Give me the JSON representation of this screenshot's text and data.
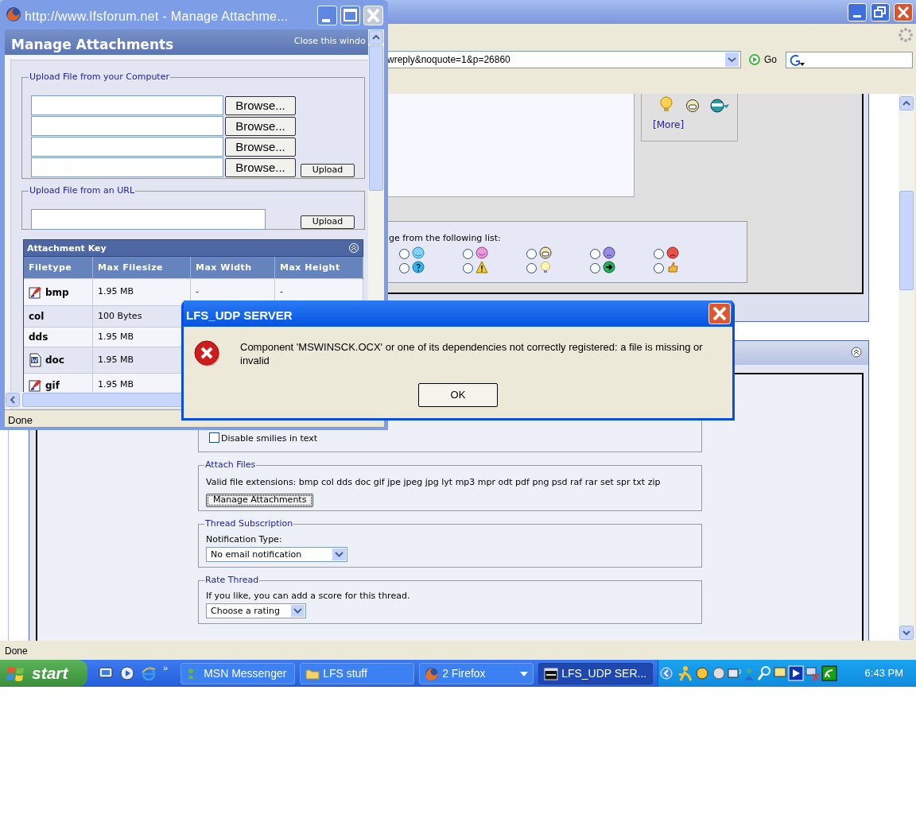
{
  "browser": {
    "address": "wreply&noquote=1&p=26860",
    "go": "Go",
    "status": "Done",
    "smilies_more": "[More]",
    "message_icon_prompt": "ge from the following list:",
    "message_icons": [
      {
        "selected": false
      },
      {
        "selected": false
      },
      {
        "selected": false
      },
      {
        "selected": false
      },
      {
        "selected": false
      },
      {
        "selected": false
      },
      {
        "selected": false
      },
      {
        "selected": false
      },
      {
        "selected": false
      },
      {
        "selected": false
      }
    ],
    "disable_smilies": {
      "label": "Disable smilies in text",
      "checked": false
    },
    "attach": {
      "legend": "Attach Files",
      "extensions": "Valid file extensions: bmp col dds doc gif jpe jpeg jpg lyt mp3 mpr odt pdf png psd raf rar set spr txt zip",
      "button": "Manage Attachments"
    },
    "subscription": {
      "legend": "Thread Subscription",
      "label": "Notification Type:",
      "value": "No email notification"
    },
    "rating": {
      "legend": "Rate Thread",
      "hint": "If you like, you can add a score for this thread.",
      "value": "Choose a rating"
    }
  },
  "popup": {
    "title": "http://www.lfsforum.net - Manage Attachme...",
    "heading": "Manage Attachments",
    "close_link": "Close this windo",
    "upload_computer": {
      "legend": "Upload File from your Computer",
      "browse": [
        "Browse...",
        "Browse...",
        "Browse...",
        "Browse..."
      ],
      "upload": "Upload"
    },
    "upload_url": {
      "legend": "Upload File from an URL",
      "upload": "Upload"
    },
    "key": {
      "title": "Attachment Key",
      "columns": [
        "Filetype",
        "Max Filesize",
        "Max Width",
        "Max Height"
      ],
      "rows": [
        {
          "kind": "image",
          "cells": [
            "bmp",
            "1.95 MB",
            "-",
            "-"
          ]
        },
        {
          "kind": "plain",
          "cells": [
            "col",
            "100 Bytes"
          ]
        },
        {
          "kind": "plain",
          "cells": [
            "dds",
            "1.95 MB"
          ]
        },
        {
          "kind": "document",
          "cells": [
            "doc",
            "1.95 MB"
          ]
        },
        {
          "kind": "image",
          "cells": [
            "gif",
            "1.95 MB"
          ]
        }
      ]
    },
    "status": "Done"
  },
  "dialog": {
    "title": "LFS_UDP SERVER",
    "message": "Component 'MSWINSCK.OCX' or one of its dependencies not correctly registered: a file is missing or invalid",
    "button": "OK"
  },
  "taskbar": {
    "start": "start",
    "more": "»",
    "tasks": [
      {
        "label": "MSN Messenger",
        "selected": false
      },
      {
        "label": "LFS stuff",
        "selected": false
      },
      {
        "label": "2 Firefox",
        "selected": false
      },
      {
        "label": "LFS_UDP SER...",
        "selected": true
      }
    ],
    "clock": "6:43 PM"
  }
}
